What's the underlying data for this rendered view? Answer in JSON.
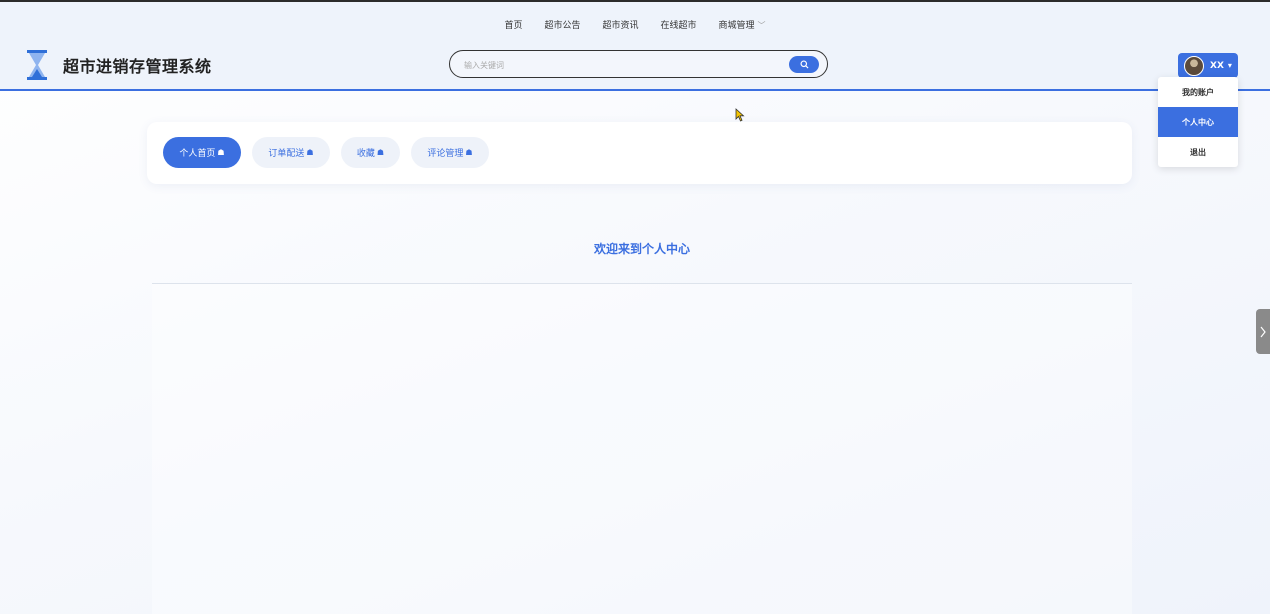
{
  "header": {
    "nav": [
      {
        "label": "首页"
      },
      {
        "label": "超市公告"
      },
      {
        "label": "超市资讯"
      },
      {
        "label": "在线超市"
      },
      {
        "label": "商城管理"
      }
    ],
    "site_title": "超市进销存管理系统",
    "search": {
      "placeholder": "输入关键词",
      "value": ""
    },
    "user": {
      "name": "XX"
    }
  },
  "user_menu": {
    "items": [
      {
        "label": "我的账户"
      },
      {
        "label": "个人中心",
        "active": true
      },
      {
        "label": "退出"
      }
    ]
  },
  "tabs": [
    {
      "label": "个人首页",
      "active": true
    },
    {
      "label": "订单配送"
    },
    {
      "label": "收藏"
    },
    {
      "label": "评论管理"
    }
  ],
  "main": {
    "welcome": "欢迎来到个人中心"
  },
  "colors": {
    "accent": "#3b6fe0",
    "header_bg": "#eef3fb"
  }
}
